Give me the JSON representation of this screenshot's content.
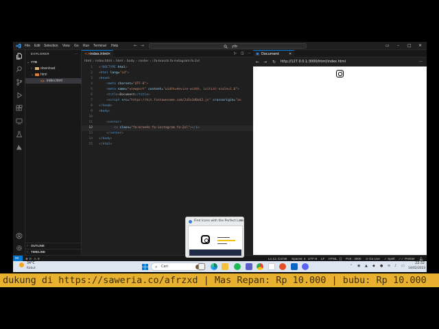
{
  "menu": [
    "File",
    "Edit",
    "Selection",
    "View",
    "Go",
    "Run",
    "Terminal",
    "Help"
  ],
  "search_box_text": "ytb",
  "explorer": {
    "title": "EXPLORER",
    "root": "YTB",
    "items": [
      {
        "label": "download",
        "type": "folder"
      },
      {
        "label": "html",
        "type": "folder"
      },
      {
        "label": "index.html",
        "type": "file"
      }
    ],
    "outline": "OUTLINE",
    "timeline": "TIMELINE"
  },
  "editor": {
    "tab": "index.html",
    "breadcrumb": [
      "html",
      "›",
      "index.html",
      "›",
      "html",
      "›",
      "body",
      "›",
      "center",
      "›",
      "i.fa-brands.fa-instagram.fa-2xl"
    ],
    "lines": [
      {
        "n": "1",
        "html": "<span class='p'>&lt;!</span><span class='d'>DOCTYPE</span> <span class='a'>html</span><span class='p'>&gt;</span>"
      },
      {
        "n": "2",
        "html": "<span class='p'>&lt;</span><span class='t'>html</span> <span class='a'>lang</span>=<span class='s'>\"id\"</span><span class='p'>&gt;</span>"
      },
      {
        "n": "3",
        "html": "<span class='p'>&lt;</span><span class='t'>head</span><span class='p'>&gt;</span>"
      },
      {
        "n": "4",
        "html": "    <span class='p'>&lt;</span><span class='t'>meta</span> <span class='a'>charset</span>=<span class='s'>\"UTF-8\"</span><span class='p'>&gt;</span>"
      },
      {
        "n": "5",
        "html": "    <span class='p'>&lt;</span><span class='t'>meta</span> <span class='a'>name</span>=<span class='s'>\"viewport\"</span> <span class='a'>content</span>=<span class='s'>\"width=device-width, initial-scale=1.0\"</span><span class='p'>&gt;</span>"
      },
      {
        "n": "6",
        "html": "    <span class='p'>&lt;</span><span class='t'>title</span><span class='p'>&gt;</span>Document<span class='p'>&lt;/</span><span class='t'>title</span><span class='p'>&gt;</span>"
      },
      {
        "n": "7",
        "html": "    <span class='p'>&lt;</span><span class='t'>script</span> <span class='a'>src</span>=<span class='s'>\"https://kit.fontawesome.com/2a5e3d0e62.js\"</span> <span class='a'>crossorigin</span>=<span class='s'>\"an</span>"
      },
      {
        "n": "8",
        "html": "<span class='p'>&lt;/</span><span class='t'>head</span><span class='p'>&gt;</span>"
      },
      {
        "n": "9",
        "html": "<span class='p'>&lt;</span><span class='t'>body</span><span class='p'>&gt;</span>"
      },
      {
        "n": "10",
        "html": ""
      },
      {
        "n": "11",
        "html": "    <span class='p'>&lt;</span><span class='t'>center</span><span class='p'>&gt;</span>"
      },
      {
        "n": "12",
        "html": "        <span class='p'>&lt;</span><span class='t'>i</span> <span class='a'>class</span>=<span class='s'>\"fa-brands fa-instagram fa-2xl\"</span><span class='p'>&gt;&lt;/</span><span class='t'>i</span><span class='p'>&gt;</span>"
      },
      {
        "n": "13",
        "html": "    <span class='p'>&lt;/</span><span class='t'>center</span><span class='p'>&gt;</span>"
      },
      {
        "n": "14",
        "html": "<span class='p'>&lt;/</span><span class='t'>body</span><span class='p'>&gt;</span>"
      },
      {
        "n": "15",
        "html": "<span class='p'>&lt;/</span><span class='t'>html</span><span class='p'>&gt;</span>"
      }
    ],
    "active_line": "12"
  },
  "preview": {
    "tab": "Document",
    "url": "http://127.0.0.1:3000/html/index.html"
  },
  "statusbar": {
    "errors": "0",
    "warnings": "0",
    "cursor": "Ln 12, Col 50",
    "spaces": "Spaces: 4",
    "encoding": "UTF-8",
    "eol": "LF",
    "language": "HTML",
    "port": "Port : 3000",
    "golive": "Go Live",
    "spell": "Spell",
    "prettier": "Prettier"
  },
  "thumbnail": {
    "title": "Find Icons with the Perfect Look..."
  },
  "taskbar": {
    "temperature": "34°C",
    "weather": "Kabut",
    "search_placeholder": "Cari",
    "time": "22:32",
    "date": "14/02/2023"
  },
  "ticker": "dukung di https://saweria.co/afrzxd | Mas Repan: Rp 10.000 | bubu: Rp 10.000",
  "colors": {
    "accent": "#0078d4",
    "ticker_bg": "#e8b230"
  }
}
